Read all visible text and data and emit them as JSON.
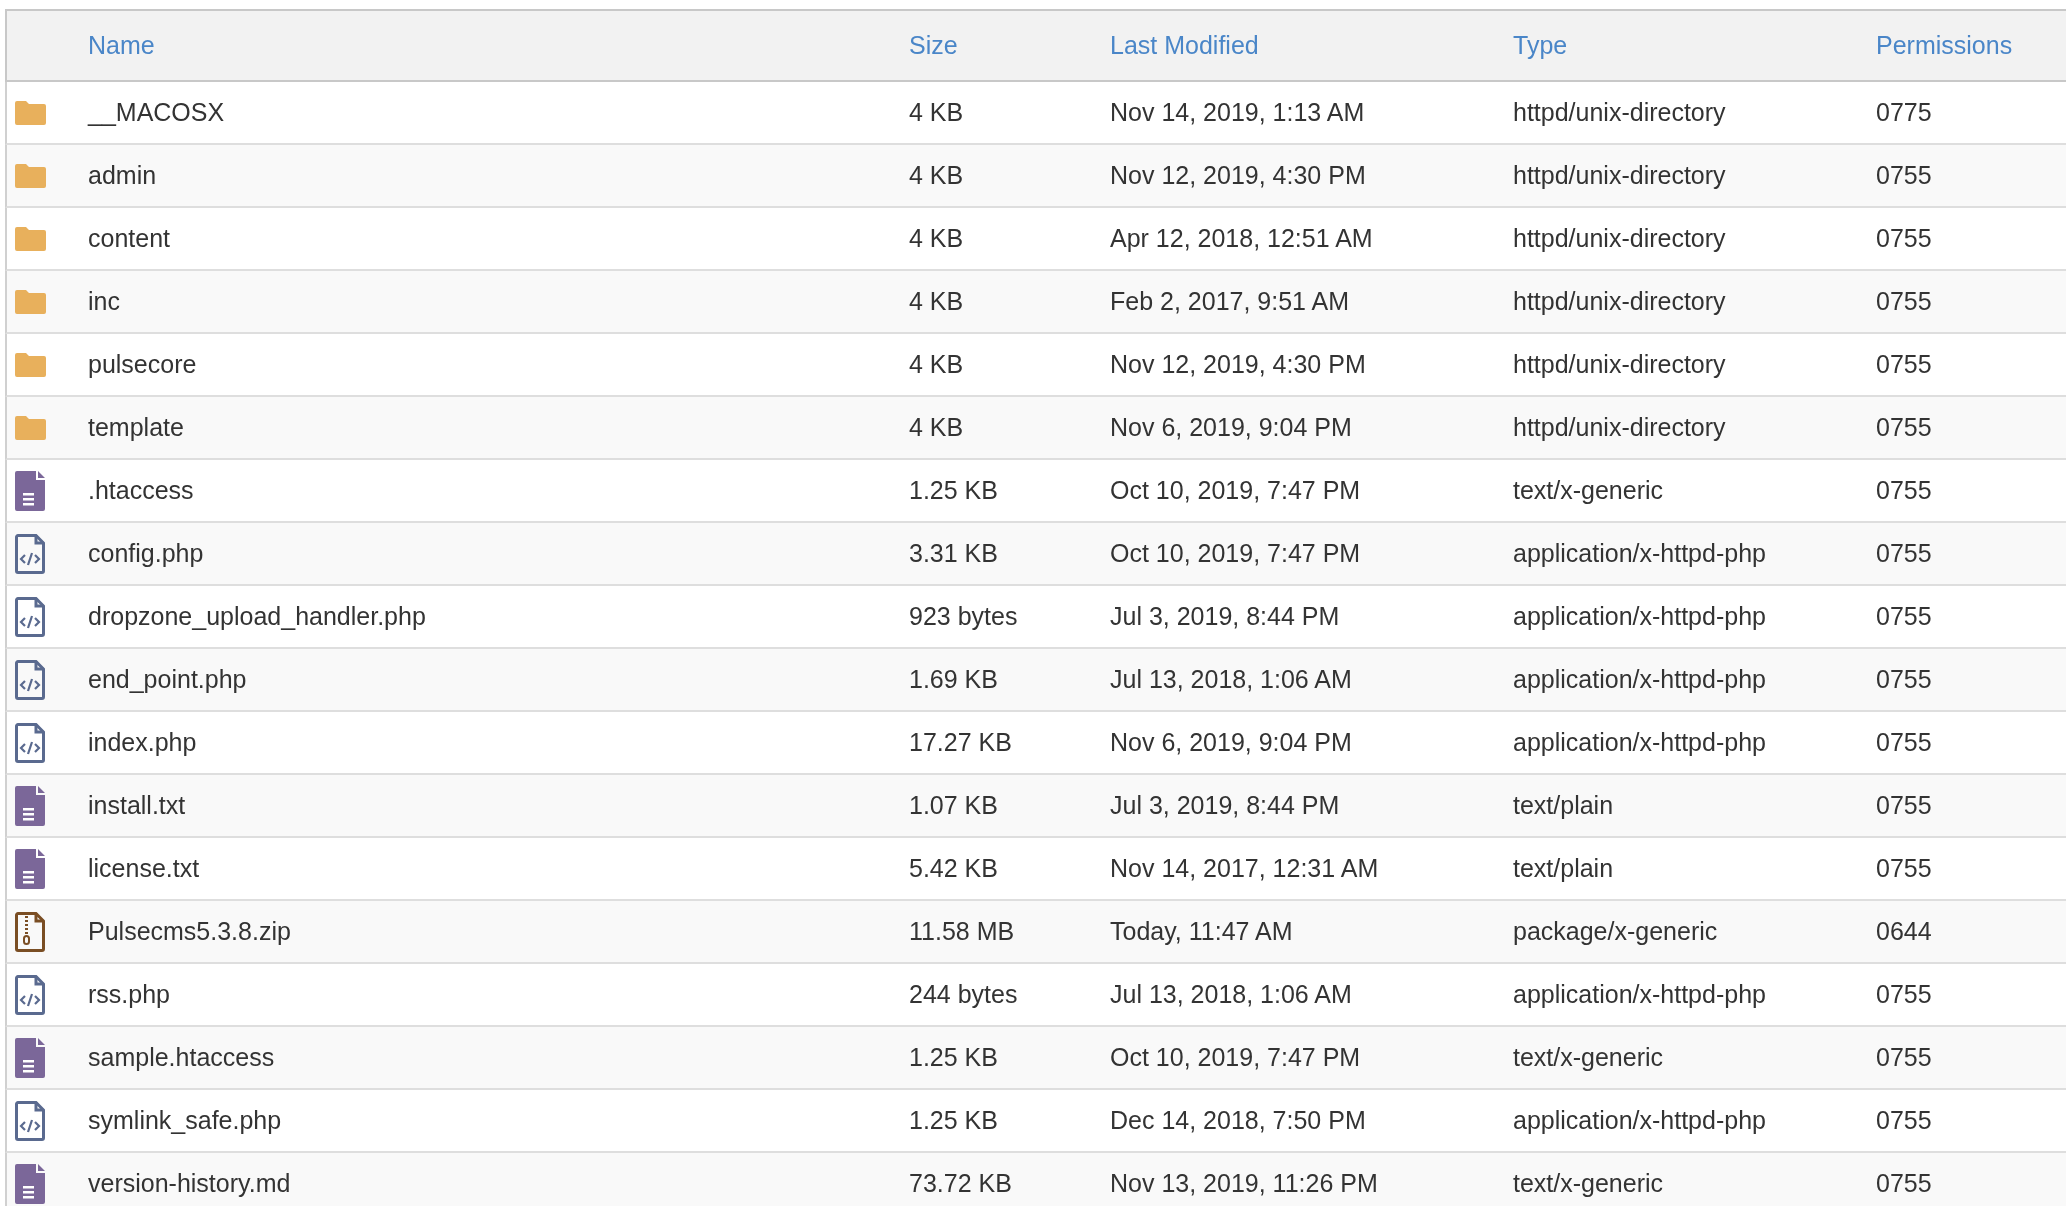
{
  "table": {
    "columns": [
      "Name",
      "Size",
      "Last Modified",
      "Type",
      "Permissions"
    ],
    "rows": [
      {
        "kind": "folder",
        "name": "__MACOSX",
        "size": "4 KB",
        "modified": "Nov 14, 2019, 1:13 AM",
        "type": "httpd/unix-directory",
        "permissions": "0775"
      },
      {
        "kind": "folder",
        "name": "admin",
        "size": "4 KB",
        "modified": "Nov 12, 2019, 4:30 PM",
        "type": "httpd/unix-directory",
        "permissions": "0755"
      },
      {
        "kind": "folder",
        "name": "content",
        "size": "4 KB",
        "modified": "Apr 12, 2018, 12:51 AM",
        "type": "httpd/unix-directory",
        "permissions": "0755"
      },
      {
        "kind": "folder",
        "name": "inc",
        "size": "4 KB",
        "modified": "Feb 2, 2017, 9:51 AM",
        "type": "httpd/unix-directory",
        "permissions": "0755"
      },
      {
        "kind": "folder",
        "name": "pulsecore",
        "size": "4 KB",
        "modified": "Nov 12, 2019, 4:30 PM",
        "type": "httpd/unix-directory",
        "permissions": "0755"
      },
      {
        "kind": "folder",
        "name": "template",
        "size": "4 KB",
        "modified": "Nov 6, 2019, 9:04 PM",
        "type": "httpd/unix-directory",
        "permissions": "0755"
      },
      {
        "kind": "text",
        "name": ".htaccess",
        "size": "1.25 KB",
        "modified": "Oct 10, 2019, 7:47 PM",
        "type": "text/x-generic",
        "permissions": "0755"
      },
      {
        "kind": "code",
        "name": "config.php",
        "size": "3.31 KB",
        "modified": "Oct 10, 2019, 7:47 PM",
        "type": "application/x-httpd-php",
        "permissions": "0755"
      },
      {
        "kind": "code",
        "name": "dropzone_upload_handler.php",
        "size": "923 bytes",
        "modified": "Jul 3, 2019, 8:44 PM",
        "type": "application/x-httpd-php",
        "permissions": "0755"
      },
      {
        "kind": "code",
        "name": "end_point.php",
        "size": "1.69 KB",
        "modified": "Jul 13, 2018, 1:06 AM",
        "type": "application/x-httpd-php",
        "permissions": "0755"
      },
      {
        "kind": "code",
        "name": "index.php",
        "size": "17.27 KB",
        "modified": "Nov 6, 2019, 9:04 PM",
        "type": "application/x-httpd-php",
        "permissions": "0755"
      },
      {
        "kind": "text",
        "name": "install.txt",
        "size": "1.07 KB",
        "modified": "Jul 3, 2019, 8:44 PM",
        "type": "text/plain",
        "permissions": "0755"
      },
      {
        "kind": "text",
        "name": "license.txt",
        "size": "5.42 KB",
        "modified": "Nov 14, 2017, 12:31 AM",
        "type": "text/plain",
        "permissions": "0755"
      },
      {
        "kind": "archive",
        "name": "Pulsecms5.3.8.zip",
        "size": "11.58 MB",
        "modified": "Today, 11:47 AM",
        "type": "package/x-generic",
        "permissions": "0644"
      },
      {
        "kind": "code",
        "name": "rss.php",
        "size": "244 bytes",
        "modified": "Jul 13, 2018, 1:06 AM",
        "type": "application/x-httpd-php",
        "permissions": "0755"
      },
      {
        "kind": "text",
        "name": "sample.htaccess",
        "size": "1.25 KB",
        "modified": "Oct 10, 2019, 7:47 PM",
        "type": "text/x-generic",
        "permissions": "0755"
      },
      {
        "kind": "code",
        "name": "symlink_safe.php",
        "size": "1.25 KB",
        "modified": "Dec 14, 2018, 7:50 PM",
        "type": "application/x-httpd-php",
        "permissions": "0755"
      },
      {
        "kind": "text",
        "name": "version-history.md",
        "size": "73.72 KB",
        "modified": "Nov 13, 2019, 11:26 PM",
        "type": "text/x-generic",
        "permissions": "0755"
      }
    ]
  }
}
